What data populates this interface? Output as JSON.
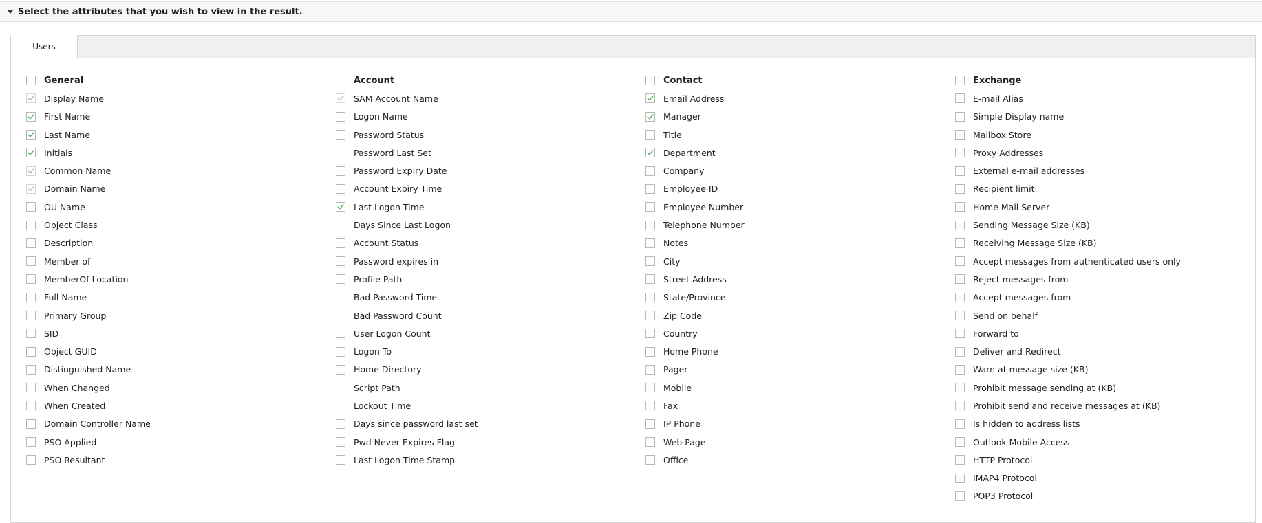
{
  "section": {
    "title": "Select the attributes that you wish to view in the result."
  },
  "tabs": [
    {
      "label": "Users"
    }
  ],
  "columns": [
    {
      "id": "general",
      "header": "General",
      "items": [
        {
          "label": "Display Name",
          "state": "disabled-checked"
        },
        {
          "label": "First Name",
          "state": "checked"
        },
        {
          "label": "Last Name",
          "state": "checked"
        },
        {
          "label": "Initials",
          "state": "checked"
        },
        {
          "label": "Common Name",
          "state": "disabled-checked"
        },
        {
          "label": "Domain Name",
          "state": "disabled-checked"
        },
        {
          "label": "OU Name",
          "state": "unchecked"
        },
        {
          "label": "Object Class",
          "state": "unchecked"
        },
        {
          "label": "Description",
          "state": "unchecked"
        },
        {
          "label": "Member of",
          "state": "unchecked"
        },
        {
          "label": "MemberOf Location",
          "state": "unchecked"
        },
        {
          "label": "Full Name",
          "state": "unchecked"
        },
        {
          "label": "Primary Group",
          "state": "unchecked"
        },
        {
          "label": "SID",
          "state": "unchecked"
        },
        {
          "label": "Object GUID",
          "state": "unchecked"
        },
        {
          "label": "Distinguished Name",
          "state": "unchecked"
        },
        {
          "label": "When Changed",
          "state": "unchecked"
        },
        {
          "label": "When Created",
          "state": "unchecked"
        },
        {
          "label": "Domain Controller Name",
          "state": "unchecked"
        },
        {
          "label": "PSO Applied",
          "state": "unchecked"
        },
        {
          "label": "PSO Resultant",
          "state": "unchecked"
        }
      ]
    },
    {
      "id": "account",
      "header": "Account",
      "items": [
        {
          "label": "SAM Account Name",
          "state": "disabled-checked"
        },
        {
          "label": "Logon Name",
          "state": "unchecked"
        },
        {
          "label": "Password Status",
          "state": "unchecked"
        },
        {
          "label": "Password Last Set",
          "state": "unchecked"
        },
        {
          "label": "Password Expiry Date",
          "state": "unchecked"
        },
        {
          "label": "Account Expiry Time",
          "state": "unchecked"
        },
        {
          "label": "Last Logon Time",
          "state": "checked"
        },
        {
          "label": "Days Since Last Logon",
          "state": "unchecked"
        },
        {
          "label": "Account Status",
          "state": "unchecked"
        },
        {
          "label": "Password expires in",
          "state": "unchecked"
        },
        {
          "label": "Profile Path",
          "state": "unchecked"
        },
        {
          "label": "Bad Password Time",
          "state": "unchecked"
        },
        {
          "label": "Bad Password Count",
          "state": "unchecked"
        },
        {
          "label": "User Logon Count",
          "state": "unchecked"
        },
        {
          "label": "Logon To",
          "state": "unchecked"
        },
        {
          "label": "Home Directory",
          "state": "unchecked"
        },
        {
          "label": "Script Path",
          "state": "unchecked"
        },
        {
          "label": "Lockout Time",
          "state": "unchecked"
        },
        {
          "label": "Days since password last set",
          "state": "unchecked"
        },
        {
          "label": "Pwd Never Expires Flag",
          "state": "unchecked"
        },
        {
          "label": "Last Logon Time Stamp",
          "state": "unchecked"
        }
      ]
    },
    {
      "id": "contact",
      "header": "Contact",
      "items": [
        {
          "label": "Email Address",
          "state": "checked"
        },
        {
          "label": "Manager",
          "state": "checked"
        },
        {
          "label": "Title",
          "state": "unchecked"
        },
        {
          "label": "Department",
          "state": "checked"
        },
        {
          "label": "Company",
          "state": "unchecked"
        },
        {
          "label": "Employee ID",
          "state": "unchecked"
        },
        {
          "label": "Employee Number",
          "state": "unchecked"
        },
        {
          "label": "Telephone Number",
          "state": "unchecked"
        },
        {
          "label": "Notes",
          "state": "unchecked"
        },
        {
          "label": "City",
          "state": "unchecked"
        },
        {
          "label": "Street Address",
          "state": "unchecked"
        },
        {
          "label": "State/Province",
          "state": "unchecked"
        },
        {
          "label": "Zip Code",
          "state": "unchecked"
        },
        {
          "label": "Country",
          "state": "unchecked"
        },
        {
          "label": "Home Phone",
          "state": "unchecked"
        },
        {
          "label": "Pager",
          "state": "unchecked"
        },
        {
          "label": "Mobile",
          "state": "unchecked"
        },
        {
          "label": "Fax",
          "state": "unchecked"
        },
        {
          "label": "IP Phone",
          "state": "unchecked"
        },
        {
          "label": "Web Page",
          "state": "unchecked"
        },
        {
          "label": "Office",
          "state": "unchecked"
        }
      ]
    },
    {
      "id": "exchange",
      "header": "Exchange",
      "items": [
        {
          "label": "E-mail Alias",
          "state": "unchecked"
        },
        {
          "label": "Simple Display name",
          "state": "unchecked"
        },
        {
          "label": "Mailbox Store",
          "state": "unchecked"
        },
        {
          "label": "Proxy Addresses",
          "state": "unchecked"
        },
        {
          "label": "External e-mail addresses",
          "state": "unchecked"
        },
        {
          "label": "Recipient limit",
          "state": "unchecked"
        },
        {
          "label": "Home Mail Server",
          "state": "unchecked"
        },
        {
          "label": "Sending Message Size (KB)",
          "state": "unchecked"
        },
        {
          "label": "Receiving Message Size (KB)",
          "state": "unchecked"
        },
        {
          "label": "Accept messages from authenticated users only",
          "state": "unchecked"
        },
        {
          "label": "Reject messages from",
          "state": "unchecked"
        },
        {
          "label": "Accept messages from",
          "state": "unchecked"
        },
        {
          "label": "Send on behalf",
          "state": "unchecked"
        },
        {
          "label": "Forward to",
          "state": "unchecked"
        },
        {
          "label": "Deliver and Redirect",
          "state": "unchecked"
        },
        {
          "label": "Warn at message size (KB)",
          "state": "unchecked"
        },
        {
          "label": "Prohibit message sending at (KB)",
          "state": "unchecked"
        },
        {
          "label": "Prohibit send and receive messages at (KB)",
          "state": "unchecked"
        },
        {
          "label": "Is hidden to address lists",
          "state": "unchecked"
        },
        {
          "label": "Outlook Mobile Access",
          "state": "unchecked"
        },
        {
          "label": "HTTP Protocol",
          "state": "unchecked"
        },
        {
          "label": "IMAP4 Protocol",
          "state": "unchecked"
        },
        {
          "label": "POP3 Protocol",
          "state": "unchecked"
        }
      ]
    }
  ],
  "colors": {
    "check_active": "#4caf50",
    "check_disabled": "#b5b5b5",
    "checkbox_border": "#b8b8b8"
  }
}
